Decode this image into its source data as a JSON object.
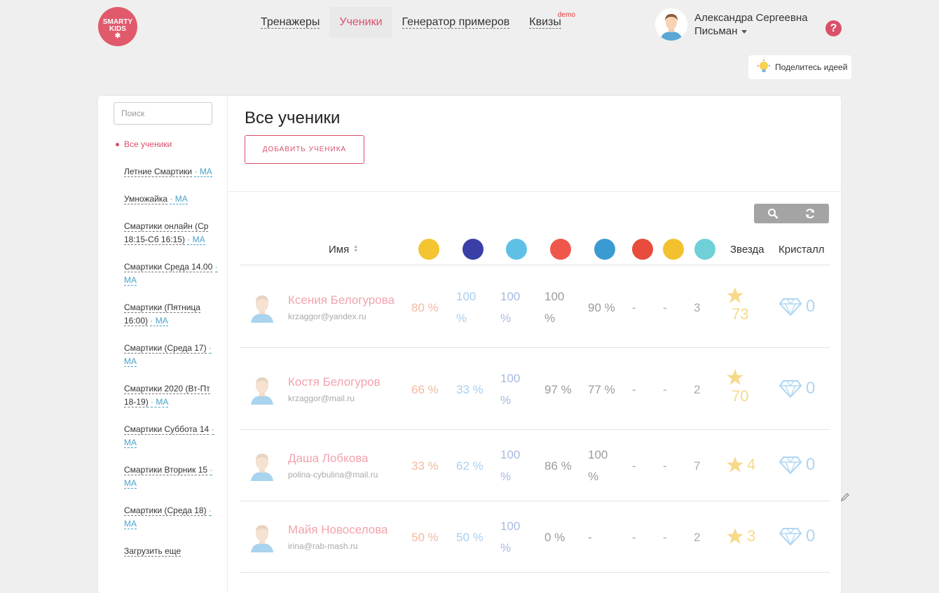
{
  "brand": {
    "line1": "SMARTY",
    "line2": "KIDS",
    "line3": "✱"
  },
  "nav": [
    {
      "label": "Тренажеры",
      "active": false
    },
    {
      "label": "Ученики",
      "active": true
    },
    {
      "label": "Генератор примеров",
      "active": false
    },
    {
      "label": "Квизы",
      "active": false,
      "badge": "demo"
    }
  ],
  "user": {
    "first_line": "Александра Сергеевна",
    "second_line": "Письман"
  },
  "help_label": "?",
  "idea_button": "Поделитесь идеей",
  "search": {
    "placeholder": "Поиск"
  },
  "groups": [
    {
      "label": "Все ученики",
      "suffix": "",
      "active": true
    },
    {
      "label": "Летние Смартики",
      "suffix": "· МА"
    },
    {
      "label": "Умножайка",
      "suffix": "· МА"
    },
    {
      "label": "Смартики онлайн (Ср 18:15-Сб 16:15)",
      "suffix": "· МА"
    },
    {
      "label": "Смартики Среда 14.00",
      "suffix": "· МА"
    },
    {
      "label": "Смартики (Пятница 16:00)",
      "suffix": "· МА"
    },
    {
      "label": "Смартики (Среда 17)",
      "suffix": "· МА"
    },
    {
      "label": "Смартики 2020 (Вт-Пт 18-19)",
      "suffix": "· МА"
    },
    {
      "label": "Смартики Суббота 14",
      "suffix": "· МА"
    },
    {
      "label": "Смартики Вторник 15",
      "suffix": "· МА"
    },
    {
      "label": "Смартики (Среда 18)",
      "suffix": "· МА"
    },
    {
      "label": "Загрузить еще",
      "suffix": ""
    }
  ],
  "main": {
    "title": "Все ученики",
    "add_button": "ДОБАВИТЬ УЧЕНИКА"
  },
  "table": {
    "col_name": "Имя",
    "col_star": "Звезда",
    "col_crystal": "Кристалл",
    "icon_colors": [
      "#f4c431",
      "#3a3fa8",
      "#5fc0e6",
      "#f0574b",
      "#3a9bd3",
      "#e74c3c",
      "#f3c12e",
      "#6fd0d8"
    ],
    "rows": [
      {
        "name": "Ксения Белогурова",
        "email": "krzaggor@yandex.ru",
        "c1": "80 %",
        "c2": "100 %",
        "c3": "100 %",
        "c4": "100 %",
        "c5": "90 %",
        "c6": "-",
        "c7": "-",
        "c8": "3",
        "stars": "73",
        "crystals": "0"
      },
      {
        "name": "Костя Белогуров",
        "email": "krzaggor@mail.ru",
        "c1": "66 %",
        "c2": "33 %",
        "c3": "100 %",
        "c4": "97 %",
        "c5": "77 %",
        "c6": "-",
        "c7": "-",
        "c8": "2",
        "stars": "70",
        "crystals": "0"
      },
      {
        "name": "Даша Лобкова",
        "email": "polina-cybulina@mail.ru",
        "c1": "33 %",
        "c2": "62 %",
        "c3": "100 %",
        "c4": "86 %",
        "c5": "100 %",
        "c6": "-",
        "c7": "-",
        "c8": "7",
        "stars": "4",
        "crystals": "0"
      },
      {
        "name": "Майя Новоселова",
        "email": "irina@rab-mash.ru",
        "c1": "50 %",
        "c2": "50 %",
        "c3": "100 %",
        "c4": "0 %",
        "c5": "-",
        "c6": "-",
        "c7": "-",
        "c8": "2",
        "stars": "3",
        "crystals": "0"
      }
    ]
  }
}
